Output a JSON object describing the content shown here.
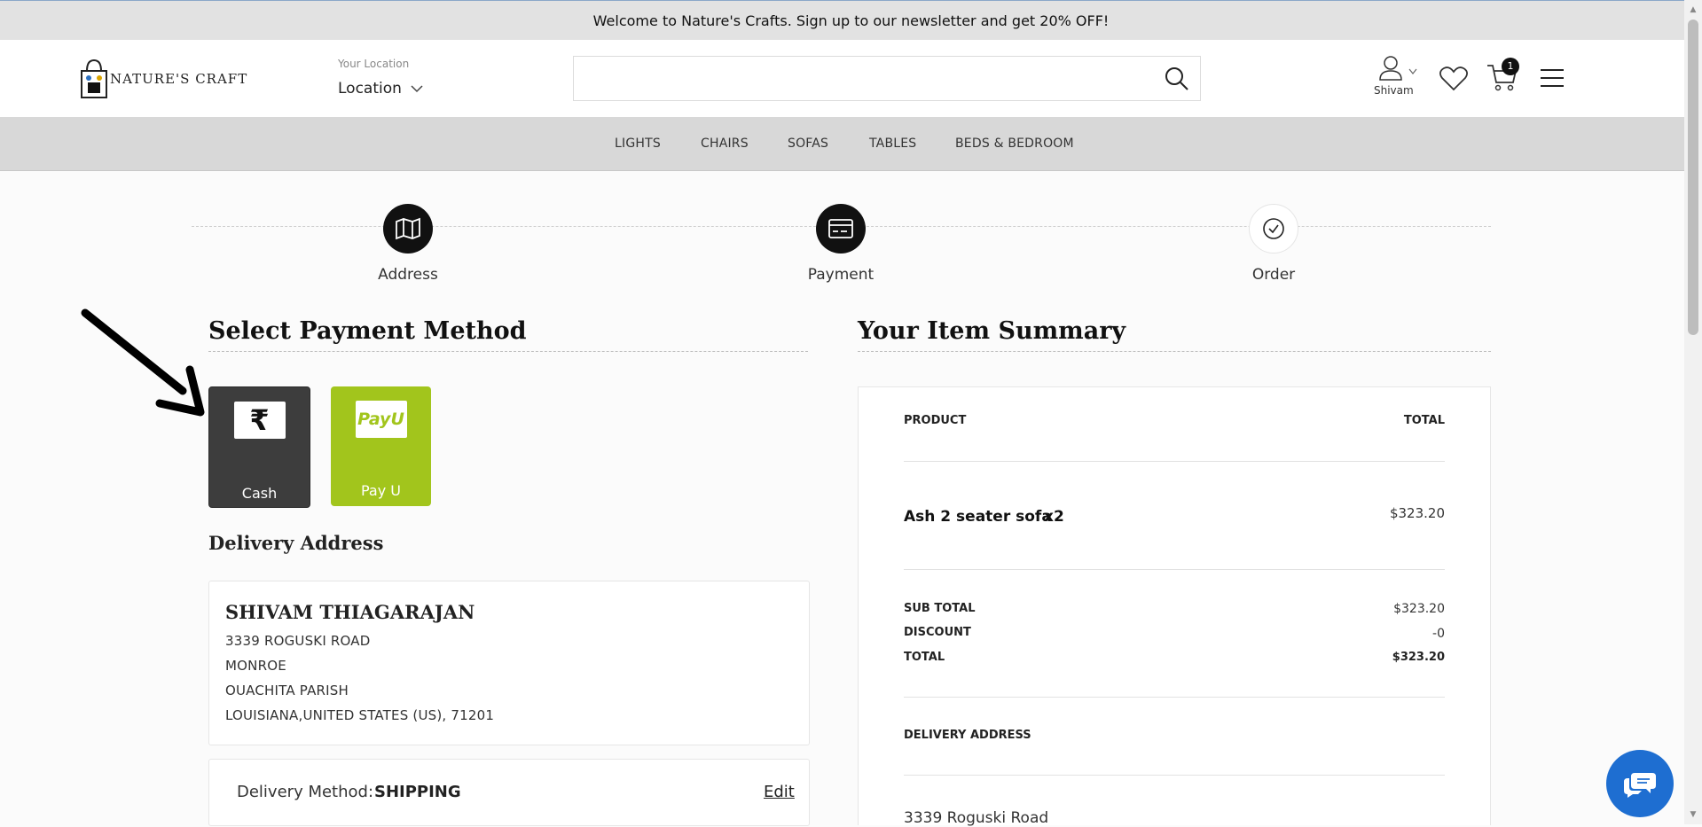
{
  "announcement": "Welcome to Nature's Crafts. Sign up to our newsletter and get 20% OFF!",
  "brand": {
    "logo_text": "NATURE'S CRAFT"
  },
  "location": {
    "caption": "Your Location",
    "value": "Location"
  },
  "search": {
    "placeholder": ""
  },
  "header": {
    "user_name": "Shivam",
    "cart_count": "1"
  },
  "nav": {
    "items": [
      "LIGHTS",
      "CHAIRS",
      "SOFAS",
      "TABLES",
      "BEDS & BEDROOM"
    ]
  },
  "steps": [
    {
      "label": "Address",
      "icon": "map-icon"
    },
    {
      "label": "Payment",
      "icon": "card-icon"
    },
    {
      "label": "Order",
      "icon": "check-circle-icon"
    }
  ],
  "payment": {
    "heading": "Select Payment Method",
    "methods": [
      {
        "label": "Cash",
        "icon": "rupee-icon",
        "color": "#3d3d3d"
      },
      {
        "label": "Pay U",
        "icon": "payu-icon",
        "logo_text": "PayU",
        "color": "#a2c51c"
      }
    ]
  },
  "delivery_address": {
    "heading": "Delivery Address",
    "name": "SHIVAM THIAGARAJAN",
    "lines": [
      "3339 ROGUSKI ROAD",
      "MONROE",
      "OUACHITA PARISH",
      "LOUISIANA,UNITED STATES (US), 71201"
    ]
  },
  "delivery_method": {
    "label": "Delivery Method:",
    "value": "SHIPPING",
    "edit": "Edit"
  },
  "summary": {
    "heading": "Your Item Summary",
    "col_product": "PRODUCT",
    "col_total": "TOTAL",
    "item_name": "Ash 2 seater sofa",
    "item_qty": "x2",
    "item_price": "$323.20",
    "subtotal_label": "SUB TOTAL",
    "subtotal": "$323.20",
    "discount_label": "DISCOUNT",
    "discount": "-0",
    "total_label": "TOTAL",
    "total": "$323.20",
    "address_label": "DELIVERY ADDRESS",
    "address_line": "3339 Roguski Road"
  },
  "colors": {
    "accent_dark": "#111111",
    "payu_green": "#a2c51c",
    "chat_blue": "#1e6ed1"
  }
}
